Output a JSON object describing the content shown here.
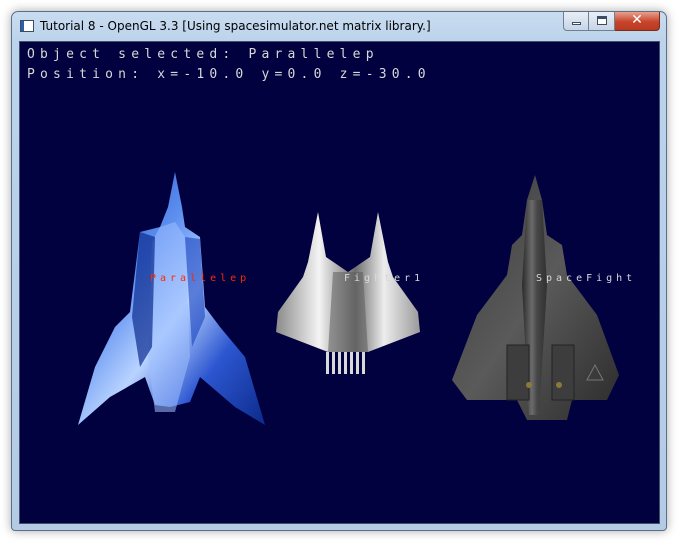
{
  "window": {
    "title": "Tutorial 8 - OpenGL 3.3 [Using spacesimulator.net matrix library.]",
    "close_glyph": "✕"
  },
  "hud": {
    "line1": "Object selected: Parallelep",
    "line2": "Position: x=-10.0 y=0.0 z=-30.0"
  },
  "colors": {
    "viewport_background": "#01013f",
    "selected_label": "#ff2a00",
    "label": "#d8d8d8"
  },
  "ships": [
    {
      "label": "Parallelep",
      "selected": true,
      "icon": "blue-fighter-model"
    },
    {
      "label": "Fighter1",
      "selected": false,
      "icon": "silver-fighter-model"
    },
    {
      "label": "SpaceFight",
      "selected": false,
      "icon": "grey-spaceship-model"
    }
  ]
}
